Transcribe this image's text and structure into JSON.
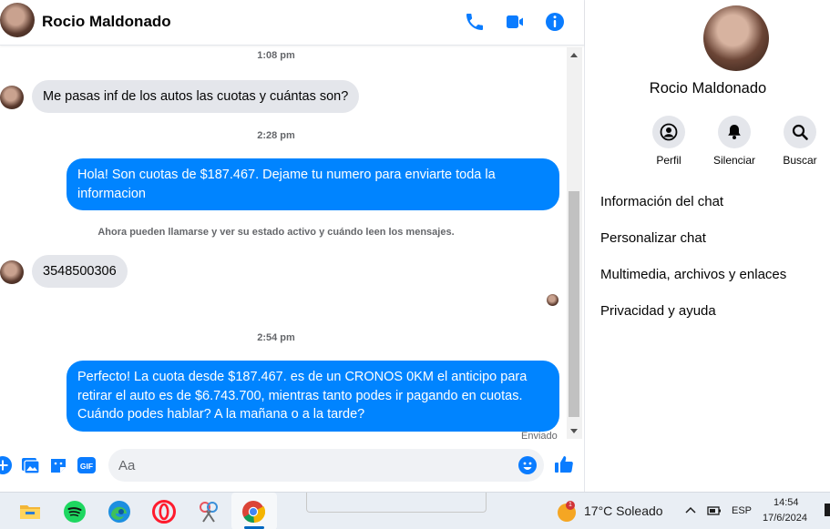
{
  "header": {
    "contact_name": "Rocio Maldonado",
    "actions": [
      "phone-icon",
      "video-icon",
      "info-icon"
    ]
  },
  "conversation": {
    "time_1": "1:08 pm",
    "msg_1": "Me pasas inf de los autos las cuotas y cuántas son?",
    "time_2": "2:28 pm",
    "msg_2": "Hola! Son cuotas de $187.467. Dejame tu numero para enviarte toda la informacion",
    "notice": "Ahora pueden llamarse y ver su estado activo y cuándo leen los mensajes.",
    "msg_3": "3548500306",
    "time_3": "2:54 pm",
    "msg_4": "Perfecto! La cuota desde $187.467. es de un CRONOS 0KM el anticipo para retirar el auto es de $6.743.700, mientras tanto podes ir pagando en cuotas. Cuándo podes hablar? A la mañana o a la tarde?",
    "status": "Enviado"
  },
  "composer": {
    "placeholder": "Aa",
    "icons": [
      "plus-icon",
      "image-icon",
      "sticker-icon",
      "gif-icon",
      "emoji-icon",
      "like-icon"
    ]
  },
  "info_panel": {
    "name": "Rocio Maldonado",
    "actions": [
      {
        "label": "Perfil",
        "icon": "profile-icon"
      },
      {
        "label": "Silenciar",
        "icon": "bell-icon"
      },
      {
        "label": "Buscar",
        "icon": "search-icon"
      }
    ],
    "menu": [
      "Información del chat",
      "Personalizar chat",
      "Multimedia, archivos y enlaces",
      "Privacidad y ayuda"
    ]
  },
  "taskbar": {
    "apps": [
      "file-explorer-icon",
      "spotify-icon",
      "edge-icon",
      "opera-icon",
      "snipping-tool-icon",
      "chrome-icon"
    ],
    "weather_badge": "1",
    "weather": "17°C  Soleado",
    "language": "ESP",
    "time": "14:54",
    "date": "17/6/2024"
  },
  "colors": {
    "accent": "#0084ff",
    "incoming_bubble": "#e4e6eb",
    "icon_blue": "#0a7cff"
  }
}
